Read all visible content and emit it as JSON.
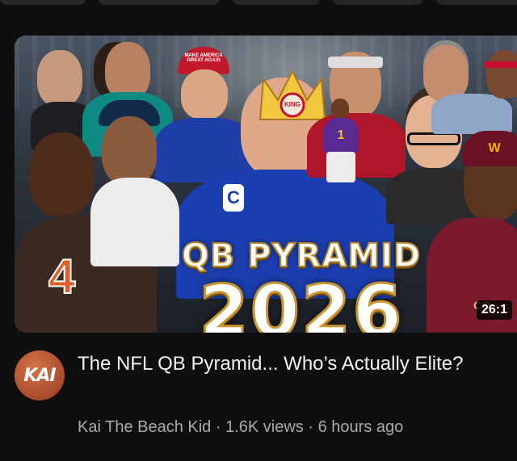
{
  "video": {
    "thumbnail": {
      "headline_top": "QB PYRAMID",
      "headline_year": "2026",
      "crown_badge": "KING",
      "hat_text": "MAKE AMERICA GREAT AGAIN",
      "jersey_center_letter": "C",
      "jersey_left_number": "4",
      "jersey_small_number": "1",
      "helmet_logo": "W",
      "corner_text": "CO",
      "duration": "26:1"
    },
    "channel_avatar_text": "KAI",
    "title": "The NFL QB Pyramid... Who’s Actually Elite?",
    "channel_name": "Kai The Beach Kid",
    "views": "1.6K views",
    "age": "6 hours ago",
    "separator": "·"
  },
  "colors": {
    "background": "#0f0f0f",
    "title_text": "#f1f1f1",
    "meta_text": "#aaaaaa",
    "avatar": "#b5552f",
    "headline_outline": "#c9952c"
  }
}
